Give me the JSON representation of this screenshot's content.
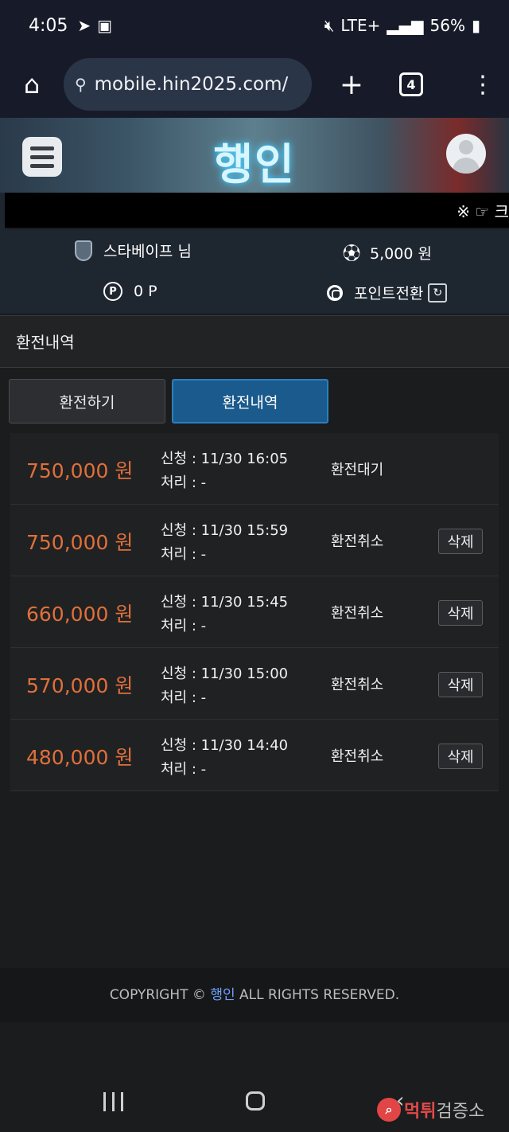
{
  "status_bar": {
    "time": "4:05",
    "network": "LTE+",
    "battery": "56%",
    "icons": [
      "telegram-icon",
      "image-icon",
      "mute-icon",
      "signal-icon",
      "battery-icon"
    ]
  },
  "browser": {
    "url": "mobile.hin2025.com/",
    "tab_count": "4",
    "icons": [
      "home-icon",
      "site-settings-icon",
      "new-tab-icon",
      "tabs-icon",
      "menu-icon"
    ]
  },
  "header": {
    "logo_text": "행인",
    "icons": [
      "hamburger-menu-icon",
      "user-avatar-icon"
    ]
  },
  "marquee": {
    "text": "※ ☞ 크"
  },
  "user_info": {
    "username": "스타베이프 님",
    "balance": "5,000 원",
    "points": "0 P",
    "point_convert_label": "포인트전환",
    "icons": [
      "rank-badge-icon",
      "soccer-ball-icon",
      "point-icon",
      "target-icon",
      "refresh-icon"
    ]
  },
  "page": {
    "title": "환전내역"
  },
  "tabs": [
    {
      "label": "환전하기",
      "active": false
    },
    {
      "label": "환전내역",
      "active": true
    }
  ],
  "history": [
    {
      "amount": "750,000 원",
      "request": "신청 : 11/30 16:05",
      "processed": "처리 : -",
      "status": "환전대기",
      "delete_label": ""
    },
    {
      "amount": "750,000 원",
      "request": "신청 : 11/30 15:59",
      "processed": "처리 : -",
      "status": "환전취소",
      "delete_label": "삭제"
    },
    {
      "amount": "660,000 원",
      "request": "신청 : 11/30 15:45",
      "processed": "처리 : -",
      "status": "환전취소",
      "delete_label": "삭제"
    },
    {
      "amount": "570,000 원",
      "request": "신청 : 11/30 15:00",
      "processed": "처리 : -",
      "status": "환전취소",
      "delete_label": "삭제"
    },
    {
      "amount": "480,000 원",
      "request": "신청 : 11/30 14:40",
      "processed": "처리 : -",
      "status": "환전취소",
      "delete_label": "삭제"
    }
  ],
  "footer": {
    "prefix": "COPYRIGHT © ",
    "brand": "행인",
    "suffix": " ALL RIGHTS RESERVED."
  },
  "watermark": {
    "part_a": "먹튀",
    "part_b": "검증소"
  },
  "colors": {
    "amount": "#e0703a",
    "active_tab": "#1a5a8c",
    "footer_brand": "#6fa0ff"
  }
}
